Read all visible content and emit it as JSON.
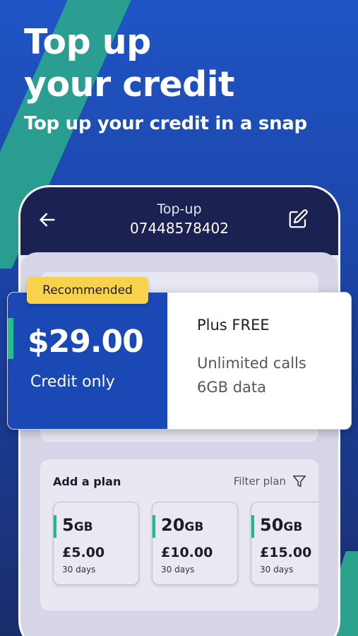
{
  "hero": {
    "title": "Top up\nyour credit",
    "subtitle": "Top up your credit in a snap"
  },
  "header": {
    "title": "Top-up",
    "number": "07448578402",
    "back_icon": "arrow-left-icon",
    "edit_icon": "edit-icon"
  },
  "featured": {
    "badge": "Recommended",
    "price": "$29.00",
    "label": "Credit only",
    "plus": "Plus FREE",
    "benefits": [
      "Unlimited calls",
      "6GB data"
    ]
  },
  "plans": {
    "heading": "Add a plan",
    "filter_label": "Filter plan",
    "filter_icon": "filter-icon",
    "items": [
      {
        "size": "5",
        "unit": "GB",
        "price": "£5.00",
        "days": "30 days"
      },
      {
        "size": "20",
        "unit": "GB",
        "price": "£10.00",
        "days": "30 days"
      },
      {
        "size": "50",
        "unit": "GB",
        "price": "£15.00",
        "days": "30 days"
      }
    ]
  },
  "colors": {
    "primary_blue": "#1a49b5",
    "navy": "#1b2150",
    "accent_green": "#22c08e",
    "badge_yellow": "#f7d24a",
    "teal_stripe": "#2aa28e"
  }
}
